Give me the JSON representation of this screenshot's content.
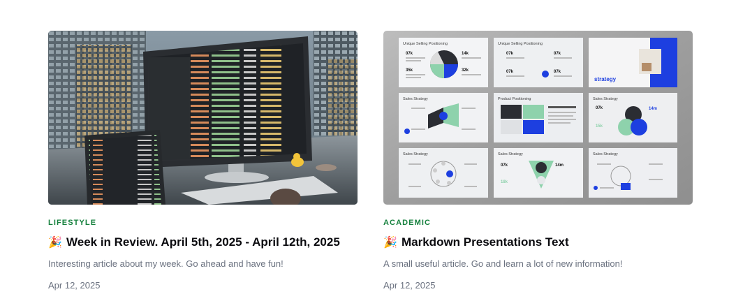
{
  "posts": [
    {
      "category": "LIFESTYLE",
      "title": "Week in Review. April 5th, 2025 - April 12th, 2025",
      "emoji": "🎉",
      "description": "Interesting article about my week. Go ahead and have fun!",
      "date": "Apr 12, 2025"
    },
    {
      "category": "ACADEMIC",
      "title": "Markdown Presentations Text",
      "emoji": "🎉",
      "description": "A small useful article. Go and learn a lot of new information!",
      "date": "Apr 12, 2025"
    }
  ],
  "slides": {
    "row1": [
      "Unique Selling Positioning",
      "Unique Selling Positioning",
      "strategy"
    ],
    "row2": [
      "Sales Strategy",
      "Product Positioning",
      "Sales Strategy"
    ],
    "row3": [
      "Sales Strategy",
      "Sales Strategy",
      "Sales Strategy"
    ],
    "stat_07k": "07k",
    "stat_14k": "14k",
    "stat_35k": "35k",
    "stat_32k": "32k",
    "stat_14m": "14m",
    "stat_15k": "15k",
    "stat_18k": "18k"
  },
  "colors": {
    "category_green": "#15803d",
    "slide_blue": "#1d3fe0",
    "slide_green": "#8ed2ac"
  },
  "icons": [
    "party-popper-icon"
  ]
}
